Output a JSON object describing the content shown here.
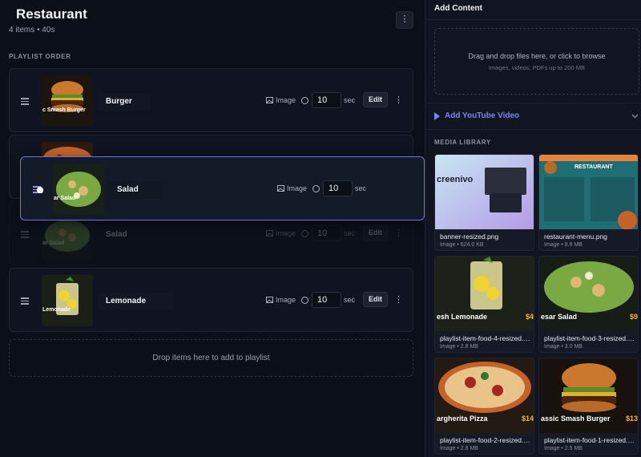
{
  "playlist": {
    "title": "Restaurant",
    "summary": "4 items • 40s",
    "section_label": "PLAYLIST ORDER",
    "more_icon": "⋮",
    "items": [
      {
        "name": "Burger",
        "thumb_caption": "c Smash Burger",
        "type": "Image",
        "duration": "10",
        "unit": "sec",
        "edit": "Edit"
      },
      {
        "name": "Salad",
        "thumb_caption": "ar Salad",
        "type": "Image",
        "duration": "10",
        "unit": "sec",
        "edit": "Edit"
      },
      {
        "name": "Salad",
        "thumb_caption": "ar Salad",
        "type": "Image",
        "duration": "10",
        "unit": "sec",
        "edit": "Edit"
      },
      {
        "name": "Lemonade",
        "thumb_caption": "Lemonade",
        "type": "Image",
        "duration": "10",
        "unit": "sec",
        "edit": "Edit"
      }
    ],
    "dropzone": "Drop items here to add to playlist"
  },
  "sidebar": {
    "title": "Add Content",
    "upload_main": "Drag and drop files here, or click to browse",
    "upload_sub": "Images, videos, PDFs up to 200 MB",
    "youtube": "Add YouTube Video",
    "library_label": "MEDIA LIBRARY",
    "media": [
      {
        "name": "banner-resized.png",
        "meta": "Image • 624.0 KB",
        "overlay": "creenivo",
        "price": ""
      },
      {
        "name": "restaurant-menu.png",
        "meta": "Image • 8.8 MB",
        "overlay": "RESTAURANT",
        "price": ""
      },
      {
        "name": "playlist-item-food-4-resized.png",
        "meta": "Image • 2.8 MB",
        "overlay": "esh Lemonade",
        "price": "$4"
      },
      {
        "name": "playlist-item-food-3-resized.png",
        "meta": "Image • 3.0 MB",
        "overlay": "esar Salad",
        "price": "$9"
      },
      {
        "name": "playlist-item-food-2-resized.png",
        "meta": "Image • 2.8 MB",
        "overlay": "argherita Pizza",
        "price": "$14"
      },
      {
        "name": "playlist-item-food-1-resized.png",
        "meta": "Image • 2.5 MB",
        "overlay": "assic Smash Burger",
        "price": "$13"
      }
    ]
  },
  "colors": {
    "accent": "#6b73e6",
    "price": "#f3b43a",
    "background": "#0b0f19"
  }
}
